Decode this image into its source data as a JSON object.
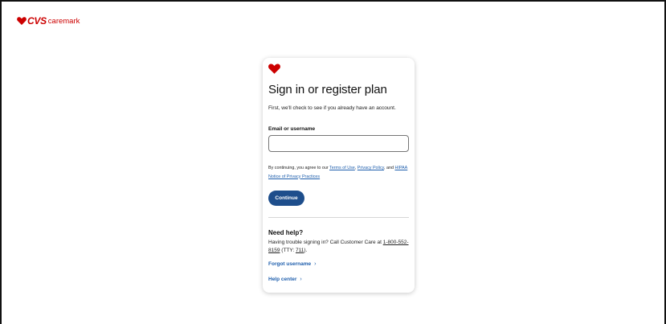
{
  "brand": {
    "cvs": "CVS",
    "caremark": "caremark",
    "color": "#cc0000"
  },
  "card": {
    "icon": "heart-icon",
    "title": "Sign in or register plan",
    "intro": "First, we'll check to see if you already have an account.",
    "field_label": "Email or username",
    "field_value": "",
    "field_placeholder": "",
    "terms": {
      "prefix": "By continuing, you agree to our ",
      "terms_link": "Terms of Use",
      "sep1": ", ",
      "privacy_link": "Privacy Policy",
      "sep2": ", and ",
      "hipaa_link": "HIPAA Notice of Privacy Practices"
    },
    "continue_label": "Continue",
    "accent": "#1e4e8c"
  },
  "help": {
    "title": "Need help?",
    "text_prefix": "Having trouble signing in? Call Customer Care at ",
    "phone": "1-800-552-8159",
    "tty_prefix": " (TTY: ",
    "tty": "711",
    "tty_suffix": ").",
    "forgot_label": "Forgot username",
    "help_center_label": "Help center",
    "chevron": "chevron-right-icon"
  }
}
